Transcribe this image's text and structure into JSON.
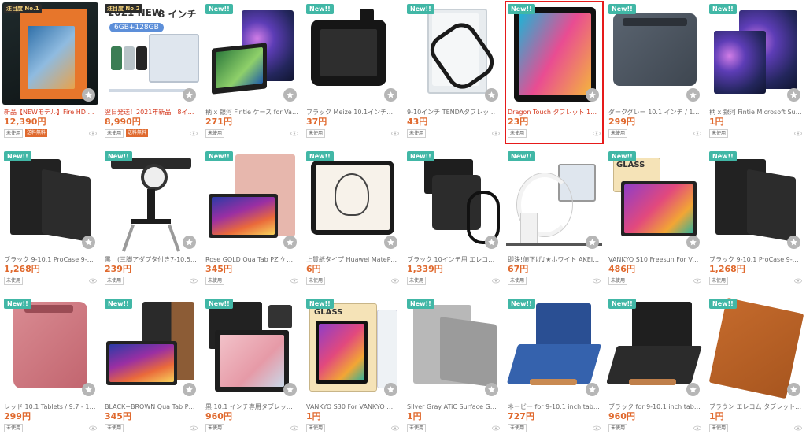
{
  "products": [
    {
      "title": "新品【NEWモデル】Fire HD 10 …",
      "price": "12,390円",
      "condition": "未使用",
      "shipping": "送料無料",
      "rank": "注目度 No.1",
      "title_red": true,
      "art": "firebox"
    },
    {
      "title": "翌日発送！2021年新品　8イン…",
      "price": "8,990円",
      "condition": "未使用",
      "shipping": "送料無料",
      "rank": "注目度 No.2",
      "title_red": true,
      "art": "new2021",
      "box_heading": "2021 NEW",
      "box_size": "8 インチ",
      "box_spec": "6GB+128GB"
    },
    {
      "title": "柄 x 銀河 Fintie ケース for Vank…",
      "price": "271円",
      "condition": "未使用",
      "badge": "New!!",
      "art": "galaxycase"
    },
    {
      "title": "ブラック Meize 10.1インチタブ…",
      "price": "37円",
      "condition": "未使用",
      "badge": "New!!",
      "art": "kidsblack"
    },
    {
      "title": "9-10インチ TENDAタブレットハ…",
      "price": "43円",
      "condition": "未使用",
      "badge": "New!!",
      "art": "clearcase"
    },
    {
      "title": "Dragon Touch タブレット 10.1…",
      "price": "23円",
      "condition": "未使用",
      "badge": "New!!",
      "art": "dragon",
      "selected": true,
      "title_red": true
    },
    {
      "title": "ダークグレー 10.1 インチ / 11 i…",
      "price": "299円",
      "condition": "未使用",
      "badge": "New!!",
      "art": "sleeve"
    },
    {
      "title": "柄 x 銀河 Fintie Microsoft Surfac…",
      "price": "1円",
      "condition": "未使用",
      "badge": "New!!",
      "art": "galaxyfolio"
    },
    {
      "title": "ブラック 9-10.1 ProCase 9-10…",
      "price": "1,268円",
      "condition": "未使用",
      "badge": "New!!",
      "art": "blackfolio"
    },
    {
      "title": "黒　(三脚アダプタ付き7-10.5イ…",
      "price": "239円",
      "condition": "未使用",
      "badge": "New!!",
      "art": "tripod"
    },
    {
      "title": "Rose GOLD Qua Tab PZ ケース …",
      "price": "345円",
      "condition": "未使用",
      "badge": "New!!",
      "art": "rosegold"
    },
    {
      "title": "上質紙タイプ Huawei MatePad P…",
      "price": "6円",
      "condition": "未使用",
      "badge": "New!!",
      "art": "sketch"
    },
    {
      "title": "ブラック 10インチ用 エレコム 防…",
      "price": "1,339円",
      "condition": "未使用",
      "badge": "New!!",
      "art": "waterproof"
    },
    {
      "title": "即決!値下げ♪★ホワイト AKEIE …",
      "price": "67円",
      "condition": "未使用",
      "badge": "New!!",
      "art": "gooseneck"
    },
    {
      "title": "VANKYO S10 Freesun For VAN…",
      "price": "486円",
      "condition": "未使用",
      "badge": "New!!",
      "art": "glass",
      "box_label": "GLASS"
    },
    {
      "title": "ブラック 9-10.1 ProCase 9-10…",
      "price": "1,268円",
      "condition": "未使用",
      "badge": "New!!",
      "art": "blackfolio"
    },
    {
      "title": "レッド 10.1 Tablets / 9.7 - 10…",
      "price": "299円",
      "condition": "未使用",
      "badge": "New!!",
      "art": "pinksleeve"
    },
    {
      "title": "BLACK+BROWN Qua Tab PZ ケ…",
      "price": "345円",
      "condition": "未使用",
      "badge": "New!!",
      "art": "blackbrown"
    },
    {
      "title": "黒 10.1 インチ専用タブレットレ…",
      "price": "960円",
      "condition": "未使用",
      "badge": "New!!",
      "art": "blackphoto"
    },
    {
      "title": "VANKYO S30 For VANKYO タブ…",
      "price": "1円",
      "condition": "未使用",
      "badge": "New!!",
      "art": "glassbox",
      "box_label": "GLASS"
    },
    {
      "title": "Silver Gray ATiC Surface Go タ…",
      "price": "1円",
      "condition": "未使用",
      "badge": "New!!",
      "art": "silver"
    },
    {
      "title": "ネービー for 9-10.1 inch tablet …",
      "price": "727円",
      "condition": "未使用",
      "badge": "New!!",
      "art": "navy"
    },
    {
      "title": "ブラック for 9-10.1 inch tablet …",
      "price": "960円",
      "condition": "未使用",
      "badge": "New!!",
      "art": "blackstand"
    },
    {
      "title": "ブラウン エレコム タブレット 汎…",
      "price": "1円",
      "condition": "未使用",
      "badge": "New!!",
      "art": "brown"
    }
  ],
  "colors": {
    "price": "#e06a2f",
    "new_badge": "#41b7a6",
    "selected_border": "#e61a1a",
    "shipping_badge": "#e06a2f"
  },
  "icons": {
    "favorite": "star-icon",
    "views": "eye-icon"
  }
}
